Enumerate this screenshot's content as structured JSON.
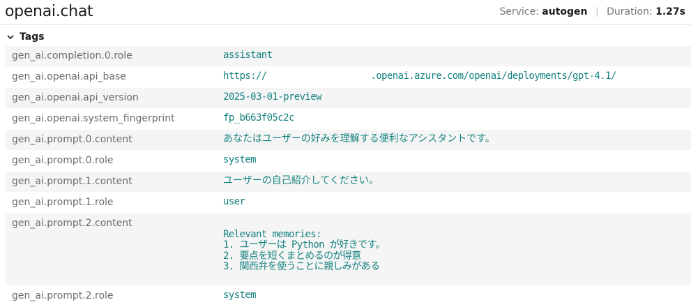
{
  "header": {
    "title": "openai.chat",
    "service_label": "Service:",
    "service_value": "autogen",
    "duration_label": "Duration:",
    "duration_value": "1.27s"
  },
  "tags": {
    "label": "Tags",
    "rows": [
      {
        "key": "gen_ai.completion.0.role",
        "value": "assistant"
      },
      {
        "key": "gen_ai.openai.api_base",
        "value": "https://                   .openai.azure.com/openai/deployments/gpt-4.1/"
      },
      {
        "key": "gen_ai.openai.api_version",
        "value": "2025-03-01-preview"
      },
      {
        "key": "gen_ai.openai.system_fingerprint",
        "value": "fp_b663f05c2c"
      },
      {
        "key": "gen_ai.prompt.0.content",
        "value": "あなたはユーザーの好みを理解する便利なアシスタントです。"
      },
      {
        "key": "gen_ai.prompt.0.role",
        "value": "system"
      },
      {
        "key": "gen_ai.prompt.1.content",
        "value": "ユーザーの自己紹介してください。"
      },
      {
        "key": "gen_ai.prompt.1.role",
        "value": "user"
      },
      {
        "key": "gen_ai.prompt.2.content",
        "value": "\nRelevant memories:\n1. ユーザーは Python が好きです。\n2. 要点を短くまとめるのが得意\n3. 関西弁を使うことに親しみがある"
      },
      {
        "key": "gen_ai.prompt.2.role",
        "value": "system"
      }
    ]
  }
}
